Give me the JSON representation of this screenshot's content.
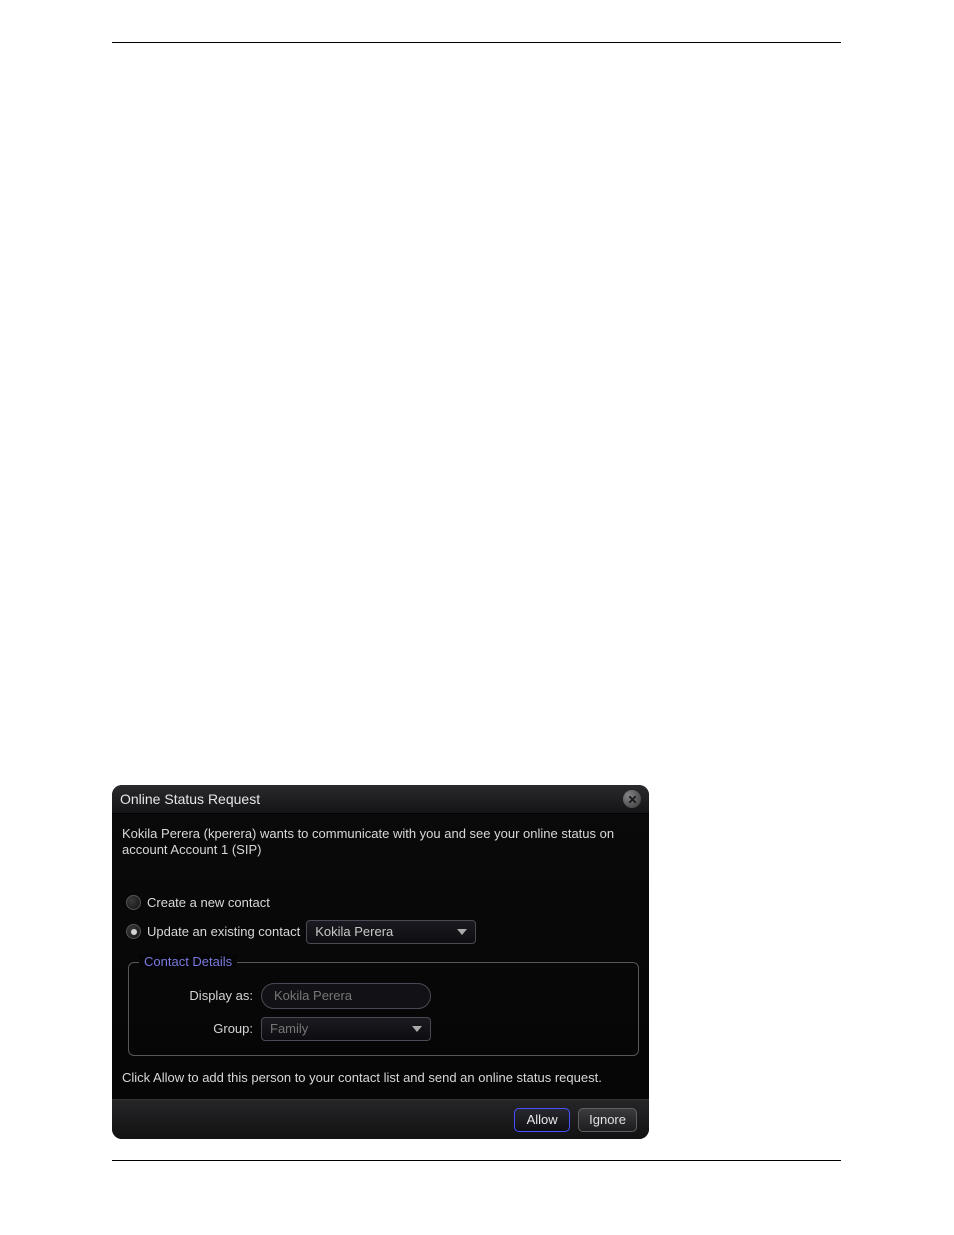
{
  "dialog": {
    "title": "Online Status Request",
    "message": "Kokila Perera (kperera) wants to communicate with you and see your online status on account Account 1 (SIP)",
    "option_create": "Create a new contact",
    "option_update": "Update an existing contact",
    "existing_contact_selected": "Kokila Perera",
    "fieldset_legend": "Contact Details",
    "display_as_label": "Display as:",
    "display_as_value": "Kokila Perera",
    "group_label": "Group:",
    "group_value": "Family",
    "hint": "Click Allow to add this person to your contact list and send an online status request.",
    "allow_label": "Allow",
    "ignore_label": "Ignore"
  }
}
